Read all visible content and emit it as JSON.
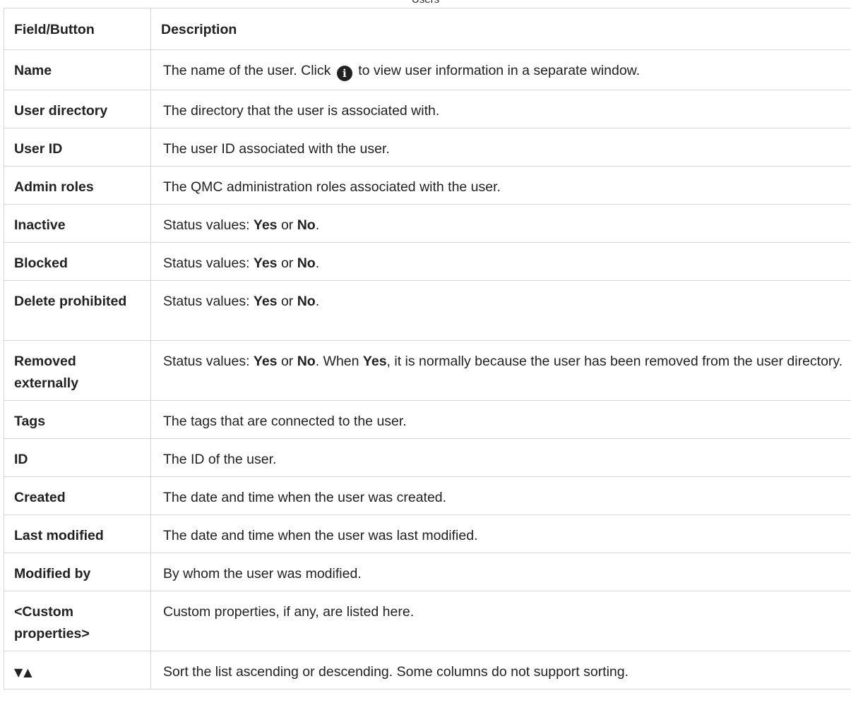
{
  "caption": "Users",
  "table": {
    "headers": [
      "Field/Button",
      "Description"
    ],
    "rows": [
      {
        "field": "Name",
        "desc_before_icon": "The name of the user. Click",
        "desc_after_icon": "to view user information in a separate window."
      },
      {
        "field": "User directory",
        "desc": "The directory that the user is associated with."
      },
      {
        "field": "User ID",
        "desc": "The user ID associated with the user."
      },
      {
        "field": "Admin roles",
        "desc": "The QMC administration roles associated with the user."
      },
      {
        "field": "Inactive",
        "status_label": "Status values:",
        "yes": "Yes",
        "or": "or",
        "no": "No",
        "end": "."
      },
      {
        "field": "Blocked",
        "status_label": "Status values:",
        "yes": "Yes",
        "or": "or",
        "no": "No",
        "end": "."
      },
      {
        "field": "Delete prohibited",
        "status_label": "Status values:",
        "yes": "Yes",
        "or": "or",
        "no": "No",
        "end": "."
      },
      {
        "field": "Removed externally",
        "status_label": "Status values:",
        "yes": "Yes",
        "or": "or",
        "no": "No",
        "mid": ". When",
        "yes2": "Yes",
        "rest": ", it is normally because the user has been removed from the user directory."
      },
      {
        "field": "Tags",
        "desc": "The tags that are connected to the user."
      },
      {
        "field": "ID",
        "desc": "The ID of the user."
      },
      {
        "field": "Created",
        "desc": "The date and time when the user was created."
      },
      {
        "field": "Last modified",
        "desc": "The date and time when the user was last modified."
      },
      {
        "field": "Modified by",
        "desc": "By whom the user was modified."
      },
      {
        "field": "<Custom properties>",
        "desc": "Custom properties, if any, are listed here."
      },
      {
        "field_icons": "▼▲",
        "desc": "Sort the list ascending or descending. Some columns do not support sorting."
      }
    ]
  },
  "icons": {
    "info": "info-circle-icon",
    "sort": "sort-arrows-icon"
  },
  "colors": {
    "border": "#d6d6d6",
    "text": "#222222"
  }
}
